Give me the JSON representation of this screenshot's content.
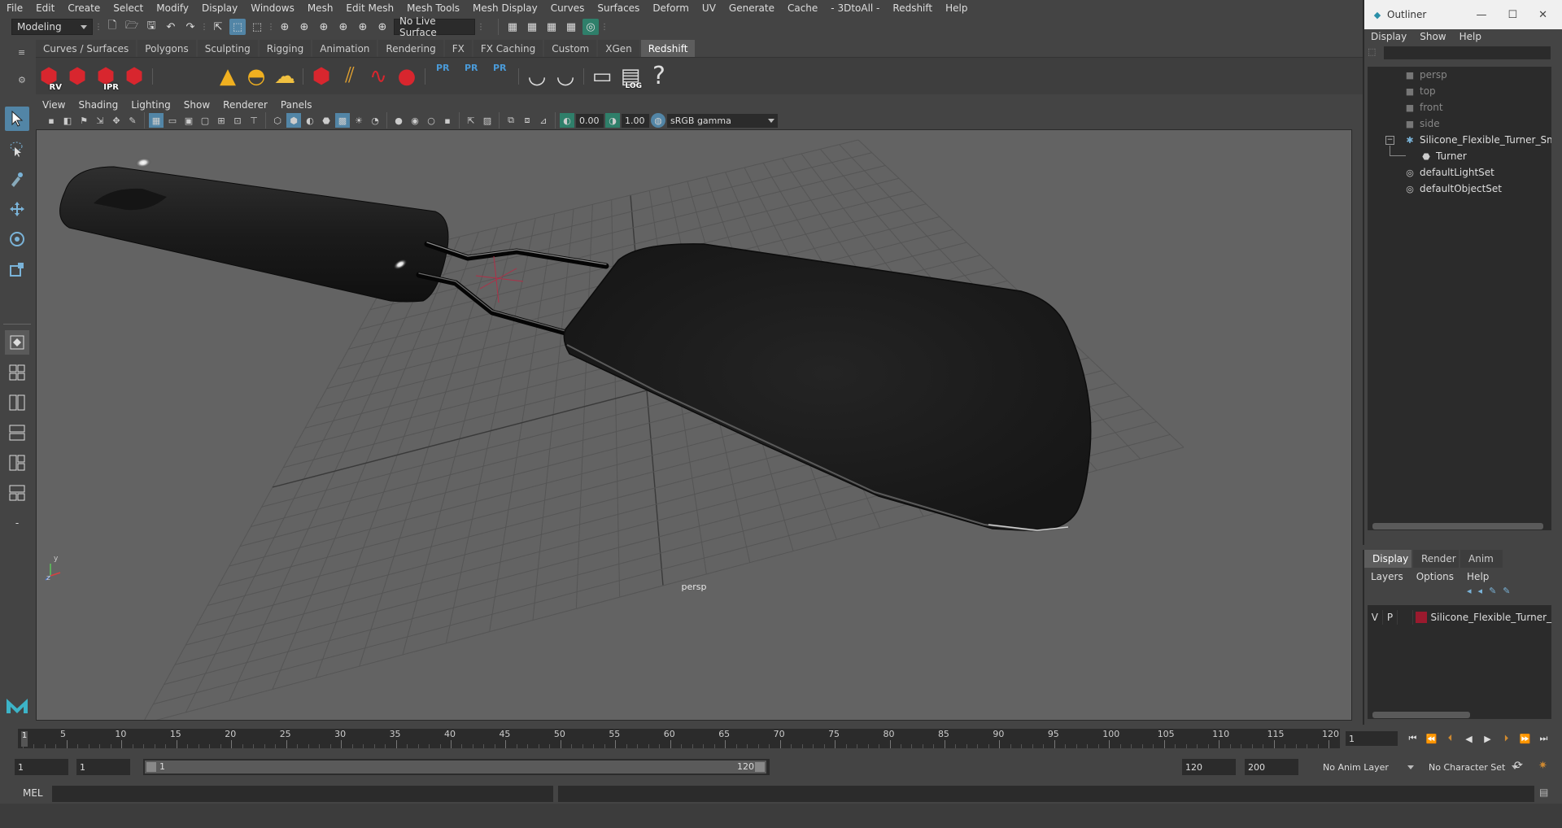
{
  "menubar": {
    "items": [
      "File",
      "Edit",
      "Create",
      "Select",
      "Modify",
      "Display",
      "Windows",
      "Mesh",
      "Edit Mesh",
      "Mesh Tools",
      "Mesh Display",
      "Curves",
      "Surfaces",
      "Deform",
      "UV",
      "Generate",
      "Cache",
      "- 3DtoAll -",
      "Redshift",
      "Help"
    ]
  },
  "statusline": {
    "menuset": "Modeling",
    "live_surface": "No Live Surface"
  },
  "shelf": {
    "tabs": [
      "Curves / Surfaces",
      "Polygons",
      "Sculpting",
      "Rigging",
      "Animation",
      "Rendering",
      "FX",
      "FX Caching",
      "Custom",
      "XGen",
      "Redshift"
    ],
    "active_tab": "Redshift",
    "buttons": [
      {
        "name": "rs-render-view",
        "label": "RV"
      },
      {
        "name": "rs-batch",
        "label": ""
      },
      {
        "name": "rs-ipr",
        "label": "IPR"
      },
      {
        "name": "rs-options",
        "label": ""
      },
      {
        "name": "rs-proxy-export",
        "label": ""
      },
      {
        "name": "rs-proxy",
        "label": ""
      },
      {
        "name": "rs-cone-light",
        "label": ""
      },
      {
        "name": "rs-dome-light",
        "label": ""
      },
      {
        "name": "rs-sun-light",
        "label": ""
      },
      {
        "name": "rs-volume",
        "label": ""
      },
      {
        "name": "rs-hair",
        "label": ""
      },
      {
        "name": "rs-curve",
        "label": ""
      },
      {
        "name": "rs-sphere",
        "label": ""
      },
      {
        "name": "rs-pr-1",
        "label": "PR"
      },
      {
        "name": "rs-pr-2",
        "label": "PR"
      },
      {
        "name": "rs-pr-3",
        "label": "PR"
      },
      {
        "name": "rs-bowl-1",
        "label": ""
      },
      {
        "name": "rs-bowl-2",
        "label": ""
      },
      {
        "name": "rs-code",
        "label": ""
      },
      {
        "name": "rs-log",
        "label": "LOG"
      },
      {
        "name": "rs-help",
        "label": "?"
      }
    ]
  },
  "viewport": {
    "menus": [
      "View",
      "Shading",
      "Lighting",
      "Show",
      "Renderer",
      "Panels"
    ],
    "exposure": "0.00",
    "gamma": "1.00",
    "color_space": "sRGB gamma",
    "camera": "persp"
  },
  "outliner": {
    "title": "Outliner",
    "menus": [
      "Display",
      "Show",
      "Help"
    ],
    "items": [
      {
        "label": "persp",
        "dim": true,
        "icon": "camera-icon"
      },
      {
        "label": "top",
        "dim": true,
        "icon": "camera-icon"
      },
      {
        "label": "front",
        "dim": true,
        "icon": "camera-icon"
      },
      {
        "label": "side",
        "dim": true,
        "icon": "camera-icon"
      },
      {
        "label": "Silicone_Flexible_Turner_Small_nc",
        "dim": false,
        "icon": "group-icon"
      },
      {
        "label": "Turner",
        "dim": false,
        "icon": "mesh-icon"
      },
      {
        "label": "defaultLightSet",
        "dim": false,
        "icon": "set-icon"
      },
      {
        "label": "defaultObjectSet",
        "dim": false,
        "icon": "set-icon"
      }
    ]
  },
  "layers": {
    "tabs": [
      "Display",
      "Render",
      "Anim"
    ],
    "active_tab": "Display",
    "menus": [
      "Layers",
      "Options",
      "Help"
    ],
    "rows": [
      {
        "v": "V",
        "p": "P",
        "color": "#9a1a2e",
        "name": "Silicone_Flexible_Turner_"
      }
    ]
  },
  "timeline": {
    "ticks": [
      "5",
      "10",
      "15",
      "20",
      "25",
      "30",
      "35",
      "40",
      "45",
      "50",
      "55",
      "60",
      "65",
      "70",
      "75",
      "80",
      "85",
      "90",
      "95",
      "100",
      "105",
      "110",
      "115",
      "120"
    ],
    "current_frame_marker": "1",
    "current_frame": "1"
  },
  "range": {
    "start": "1",
    "start_inner": "1",
    "slider_start": "1",
    "slider_end": "120",
    "end_inner": "120",
    "end": "200",
    "anim_layer": "No Anim Layer",
    "character_set": "No Character Set"
  },
  "cmdline": {
    "label": "MEL"
  },
  "colors": {
    "accent": "#5285a6",
    "redshift_red": "#d8262e",
    "viewport_bg": "#636363"
  }
}
